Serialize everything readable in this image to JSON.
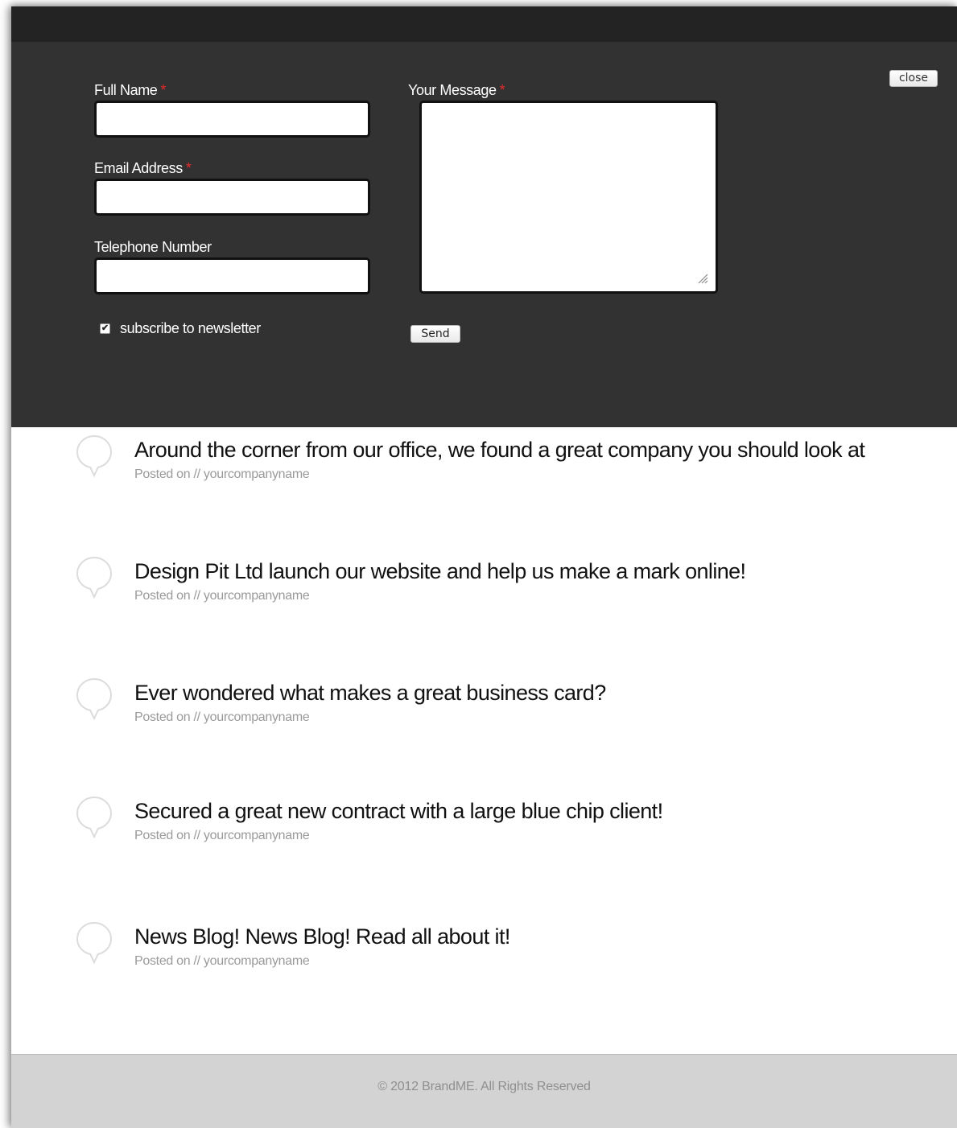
{
  "contact_form": {
    "close_label": "close",
    "full_name": {
      "label": "Full Name",
      "required_mark": "*",
      "value": ""
    },
    "email": {
      "label": "Email Address",
      "required_mark": "*",
      "value": ""
    },
    "telephone": {
      "label": "Telephone Number",
      "value": ""
    },
    "message": {
      "label": "Your Message",
      "required_mark": "*",
      "value": ""
    },
    "subscribe": {
      "label": "subscribe to newsletter",
      "checked": true,
      "check_glyph": "✔"
    },
    "send_label": "Send"
  },
  "posts": [
    {
      "title": "Around the corner from our office, we found a great company you should look at",
      "meta": "Posted on // yourcompanyname"
    },
    {
      "title": "Design Pit Ltd launch our website and help us make a mark online!",
      "meta": "Posted on // yourcompanyname"
    },
    {
      "title": "Ever wondered what makes a great business card?",
      "meta": "Posted on // yourcompanyname"
    },
    {
      "title": "Secured a great new contract with a large blue chip client!",
      "meta": "Posted on // yourcompanyname"
    },
    {
      "title": "News Blog! News Blog! Read all about it!",
      "meta": "Posted on // yourcompanyname"
    }
  ],
  "footer": {
    "copyright": "© 2012 BrandME. All Rights Reserved"
  },
  "colors": {
    "panel_bg": "#323232",
    "topbar_bg": "#232323",
    "required": "#e52a2a",
    "footer_bg": "#d3d3d3"
  },
  "icons": {
    "post_bubble": "speech-bubble-icon",
    "checkbox": "checkmark-icon",
    "textarea_grip": "resize-grip-icon"
  }
}
